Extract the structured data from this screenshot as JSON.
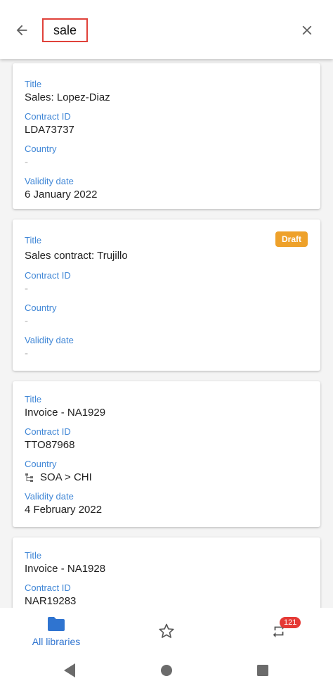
{
  "search": {
    "query": "sale"
  },
  "labels": {
    "title": "Title",
    "contract_id": "Contract ID",
    "country": "Country",
    "validity_date": "Validity date"
  },
  "cards": [
    {
      "title": "Sales: Lopez-Diaz",
      "contract_id": "LDA73737",
      "country": "-",
      "validity_date": "6 January 2022"
    },
    {
      "title": "Sales contract: Trujillo",
      "badge": "Draft",
      "contract_id": "-",
      "country": "-",
      "validity_date": "-"
    },
    {
      "title": "Invoice - NA1929",
      "contract_id": "TTO87968",
      "country": "SOA > CHI",
      "validity_date": "4 February 2022"
    },
    {
      "title": "Invoice - NA1928",
      "contract_id": "NAR19283"
    }
  ],
  "bottom_nav": {
    "libraries_label": "All libraries",
    "sync_count": "121"
  },
  "colors": {
    "accent": "#3f86d6",
    "badge_draft": "#eea12a",
    "notification": "#e53935",
    "search_highlight": "#e0423a"
  },
  "icons": {
    "back": "arrow-left-icon",
    "close": "close-icon",
    "libraries": "folder-icon",
    "favorites": "star-icon",
    "sync": "sync-icon",
    "country": "hierarchy-icon"
  }
}
